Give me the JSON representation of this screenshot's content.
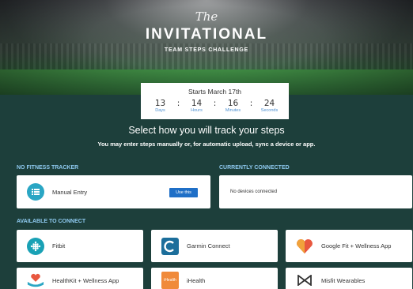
{
  "hero": {
    "script_title": "The",
    "main_title": "INVITATIONAL",
    "subtitle": "TEAM STEPS CHALLENGE"
  },
  "countdown": {
    "starts_text": "Starts March 17th",
    "days": "13",
    "hours": "14",
    "minutes": "16",
    "seconds": "24",
    "separator": ":",
    "days_label": "Days",
    "hours_label": "Hours",
    "minutes_label": "Minutes",
    "seconds_label": "Seconds"
  },
  "headline": "Select how you will track your steps",
  "subline": "You may enter steps manually or, for automatic upload, sync a device or app.",
  "sections": {
    "no_tracker": "NO FITNESS TRACKER",
    "connected": "CURRENTLY CONNECTED",
    "available": "AVAILABLE TO CONNECT"
  },
  "manual": {
    "label": "Manual Entry",
    "button": "Use this"
  },
  "connected": {
    "empty_text": "No devices connected"
  },
  "apps": {
    "fitbit": "Fitbit",
    "garmin": "Garmin Connect",
    "googlefit": "Google Fit + Wellness App",
    "healthkit": "HealthKit + Wellness App",
    "ihealth": "iHealth",
    "ihealth_logo": "iHealth",
    "misfit": "Misfit Wearables"
  },
  "colors": {
    "background": "#1d3f3b",
    "accent_label": "#8ec9ef",
    "button": "#1f6fc7",
    "fitbit": "#19a1b5",
    "garmin": "#1c6e9b",
    "ihealth": "#f08a3a"
  },
  "icons": {
    "manual": "list-icon",
    "fitbit": "fitbit-dots-icon",
    "garmin": "garmin-c-icon",
    "googlefit": "heart-icon",
    "healthkit": "heart-hand-icon",
    "ihealth": "ihealth-logo",
    "misfit": "misfit-bowtie-icon"
  }
}
